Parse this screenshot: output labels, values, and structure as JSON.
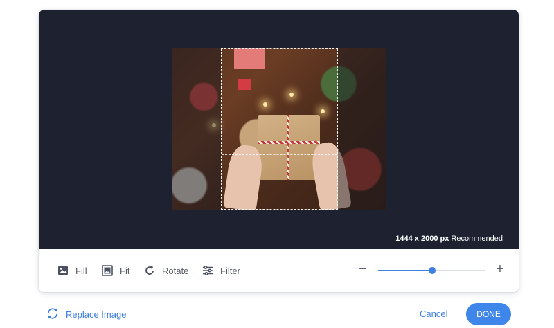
{
  "preview": {
    "size_text": "1444 x 2000 px",
    "size_suffix": "Recommended"
  },
  "toolbar": {
    "tools": [
      {
        "label": "Fill",
        "icon": "image-fill-icon"
      },
      {
        "label": "Fit",
        "icon": "image-fit-icon"
      },
      {
        "label": "Rotate",
        "icon": "rotate-icon"
      },
      {
        "label": "Filter",
        "icon": "sliders-filter-icon"
      }
    ],
    "zoom": {
      "minus": "−",
      "plus": "+",
      "level": 0.5
    }
  },
  "footer": {
    "replace_label": "Replace Image",
    "cancel_label": "Cancel",
    "done_label": "DONE"
  },
  "colors": {
    "accent": "#3f7fe0",
    "stage_bg": "#1e2230"
  }
}
